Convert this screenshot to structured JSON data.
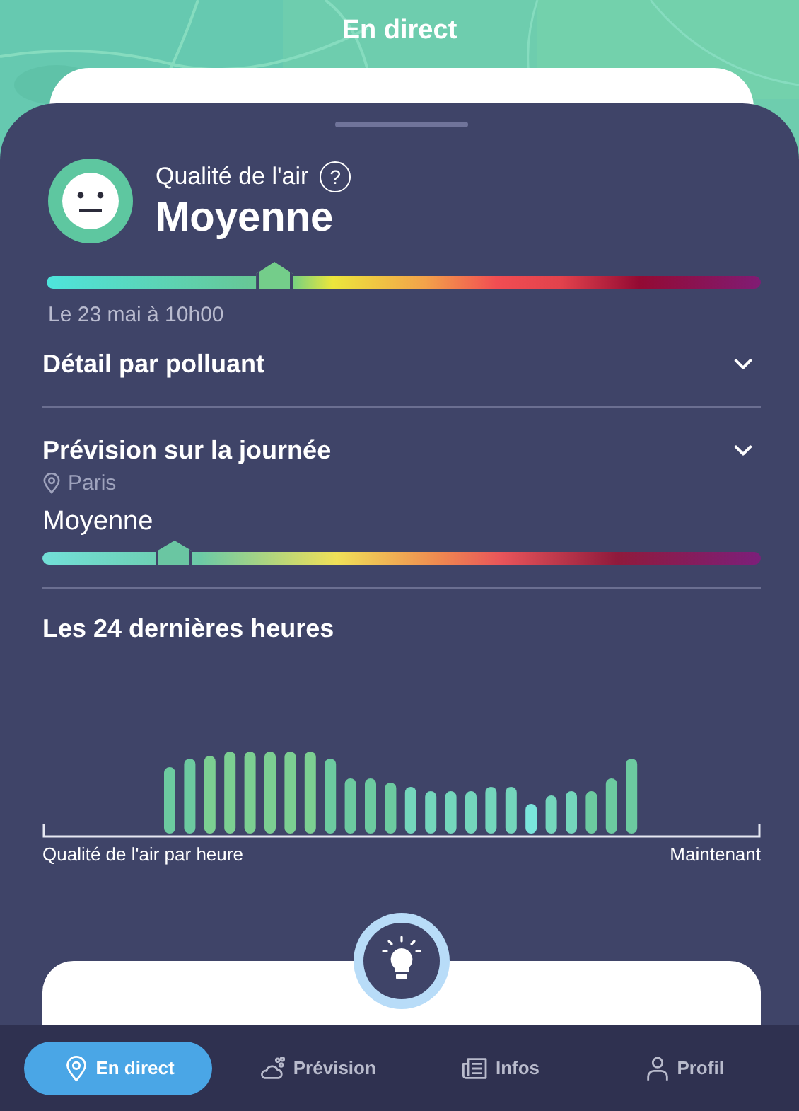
{
  "header": {
    "title": "En direct"
  },
  "air_quality": {
    "label": "Qualité de l'air",
    "help": "?",
    "value": "Moyenne",
    "level": 0.315,
    "date": "Le 23 mai à 10h00"
  },
  "pollutant_detail": {
    "title": "Détail par polluant"
  },
  "forecast": {
    "title": "Prévision sur la journée",
    "location": "Paris",
    "value": "Moyenne",
    "level": 0.18
  },
  "last_24h": {
    "title": "Les 24 dernières heures",
    "left_label": "Qualité de l'air par heure",
    "right_label": "Maintenant"
  },
  "nav": [
    {
      "label": "En direct",
      "selected": true
    },
    {
      "label": "Prévision",
      "selected": false
    },
    {
      "label": "Infos",
      "selected": false
    },
    {
      "label": "Profil",
      "selected": false
    }
  ]
}
